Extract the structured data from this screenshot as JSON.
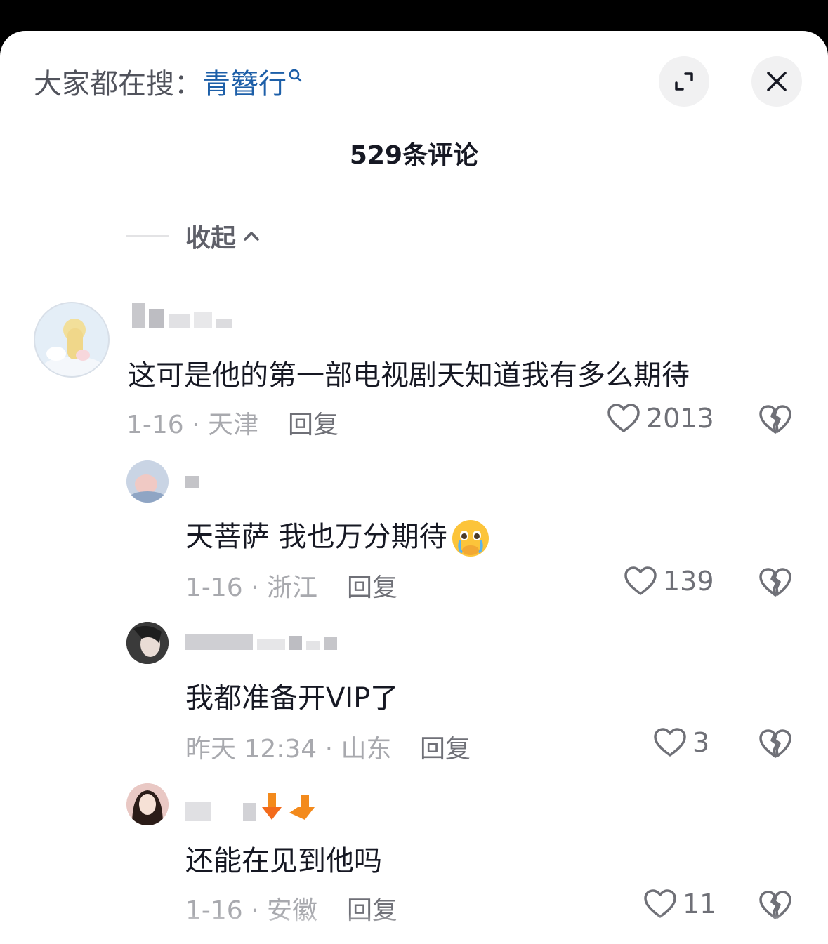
{
  "header": {
    "search_prefix": "大家都在搜：",
    "search_term": "青簪行",
    "expand_icon": "expand-icon",
    "close_icon": "close-icon"
  },
  "comment_count_label": "529条评论",
  "collapse_label": "收起",
  "comments": [
    {
      "text": "这可是他的第一部电视剧天知道我有多么期待",
      "date_location": "1-16 · 天津",
      "reply_label": "回复",
      "likes": "2013"
    },
    {
      "text": "天菩萨 我也万分期待",
      "emoji": "crying-face-emoji",
      "date_location": "1-16 · 浙江",
      "reply_label": "回复",
      "likes": "139"
    },
    {
      "text": "我都准备开VIP了",
      "date_location": "昨天 12:34 · 山东",
      "reply_label": "回复",
      "likes": "3"
    },
    {
      "text": "还能在见到他吗",
      "date_location": "1-16 · 安徽",
      "reply_label": "回复",
      "likes": "11"
    }
  ],
  "colors": {
    "accent_link": "#1d5fa8",
    "text_primary": "#161823",
    "text_meta": "#a8a9ae"
  }
}
